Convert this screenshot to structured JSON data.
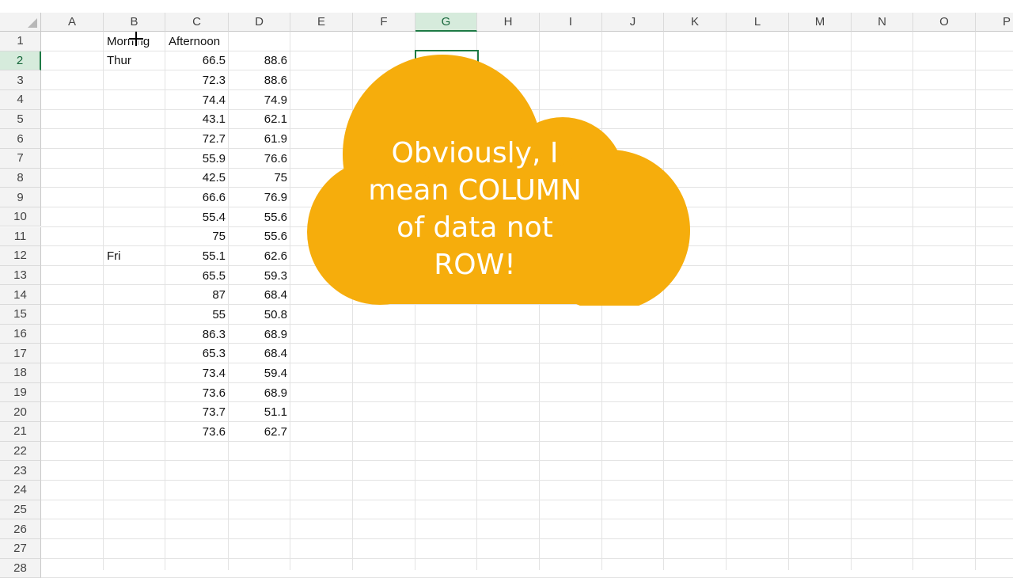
{
  "columns": [
    "A",
    "B",
    "C",
    "D",
    "E",
    "F",
    "G",
    "H",
    "I",
    "J",
    "K",
    "L",
    "M",
    "N",
    "O",
    "P"
  ],
  "selected_column": "G",
  "rows": [
    "1",
    "2",
    "3",
    "4",
    "5",
    "6",
    "7",
    "8",
    "9",
    "10",
    "11",
    "12",
    "13",
    "14",
    "15",
    "16",
    "17",
    "18",
    "19",
    "20",
    "21",
    "22",
    "23",
    "24",
    "25",
    "26",
    "27",
    "28"
  ],
  "selected_row": "2",
  "headers": {
    "morning": "Morning",
    "afternoon": "Afternoon"
  },
  "day_labels": [
    {
      "row": 2,
      "label": "Thur"
    },
    {
      "row": 12,
      "label": "Fri"
    }
  ],
  "table": {
    "morning": [
      "66.5",
      "72.3",
      "74.4",
      "43.1",
      "72.7",
      "55.9",
      "42.5",
      "66.6",
      "55.4",
      "75",
      "55.1",
      "65.5",
      "87",
      "55",
      "86.3",
      "65.3",
      "73.4",
      "73.6",
      "73.7",
      "73.6"
    ],
    "afternoon": [
      "88.6",
      "88.6",
      "74.9",
      "62.1",
      "61.9",
      "76.6",
      "75",
      "76.9",
      "55.6",
      "55.6",
      "62.6",
      "59.3",
      "68.4",
      "50.8",
      "68.9",
      "68.4",
      "59.4",
      "68.9",
      "51.1",
      "62.7"
    ]
  },
  "callout": {
    "lines": [
      "Obviously, I",
      "mean COLUMN",
      "of data not",
      "ROW!"
    ],
    "color": "#f6ad0c"
  },
  "colors": {
    "selection": "#1e7a45",
    "header_bg": "#f3f3f3",
    "gridline": "#e3e3e3"
  }
}
